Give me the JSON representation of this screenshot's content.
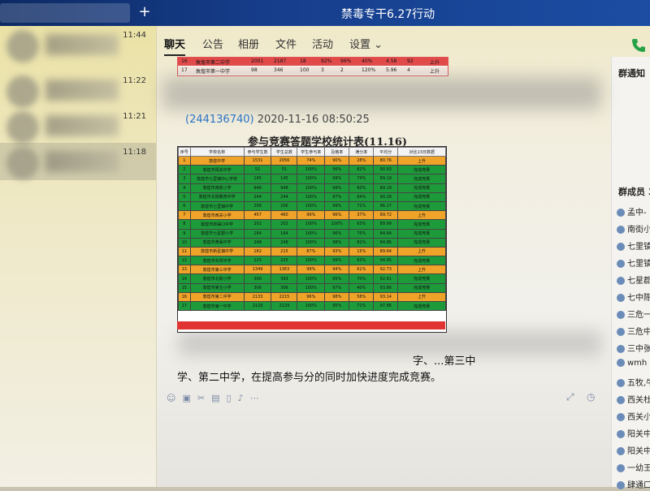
{
  "window": {
    "title": "禁毒专干6.27行动"
  },
  "sidebar": {
    "conversations": [
      {
        "time": "11:44"
      },
      {
        "time": "11:22"
      },
      {
        "time": "11:21"
      },
      {
        "time": "11:18",
        "selected": true
      }
    ]
  },
  "nav": {
    "tabs": [
      "聊天",
      "公告",
      "相册",
      "文件",
      "活动",
      "设置 ⌄"
    ],
    "active": 0
  },
  "right_panel": {
    "title": "群通知",
    "members_label": "群成员 3",
    "members": [
      "孟中-",
      "南街小",
      "七里镇",
      "七里镇",
      "七星郡",
      "七中陈",
      "三危一",
      "三危中",
      "三中张",
      "wmh",
      "五牧,牛",
      "西关杜",
      "西关小",
      "阳关中",
      "阳关中",
      "一幼王",
      "肆通口"
    ]
  },
  "chat": {
    "timestamp_id": "(244136740)",
    "timestamp": "2020-11-16 08:50:25",
    "table_title": "参与竞赛答题学校统计表(11.16)",
    "headers": [
      "序号",
      "学校名称",
      "参与学生数",
      "学生总数",
      "学生参与率",
      "及格率",
      "满分率",
      "平均分",
      "对比13日数据"
    ],
    "rows": [
      {
        "c": "o",
        "cells": [
          "1",
          "敦煌中学",
          "1531",
          "2056",
          "74%",
          "90%",
          "28%",
          "80.76",
          "上升"
        ]
      },
      {
        "c": "g",
        "cells": [
          "2",
          "敦煌市阳关中学",
          "51",
          "51",
          "100%",
          "96%",
          "82%",
          "90.93",
          "完成竞赛"
        ]
      },
      {
        "c": "g",
        "cells": [
          "3",
          "敦煌市七里镇中心学校",
          "145",
          "145",
          "100%",
          "99%",
          "74%",
          "89.19",
          "完成竞赛"
        ]
      },
      {
        "c": "g",
        "cells": [
          "4",
          "敦煌市南街小学",
          "946",
          "948",
          "100%",
          "99%",
          "60%",
          "89.19",
          "完成竞赛"
        ]
      },
      {
        "c": "g",
        "cells": [
          "5",
          "敦煌市北街教育中学",
          "244",
          "244",
          "100%",
          "97%",
          "64%",
          "90.28",
          "完成竞赛"
        ]
      },
      {
        "c": "g",
        "cells": [
          "6",
          "敦煌市七里镇中学",
          "206",
          "206",
          "100%",
          "99%",
          "71%",
          "96.17",
          "完成竞赛"
        ]
      },
      {
        "c": "o",
        "cells": [
          "7",
          "敦煌市西关小学",
          "457",
          "460",
          "99%",
          "96%",
          "37%",
          "89.72",
          "上升"
        ]
      },
      {
        "c": "g",
        "cells": [
          "8",
          "敦煌市转渠口中学",
          "202",
          "202",
          "100%",
          "100%",
          "63%",
          "89.99",
          "完成竞赛"
        ]
      },
      {
        "c": "g",
        "cells": [
          "9",
          "敦煌市七星郡小学",
          "164",
          "164",
          "100%",
          "96%",
          "75%",
          "84.64",
          "完成竞赛"
        ]
      },
      {
        "c": "g",
        "cells": [
          "10",
          "敦煌市黄渠中学",
          "248",
          "248",
          "100%",
          "98%",
          "82%",
          "84.86",
          "完成竞赛"
        ]
      },
      {
        "c": "o",
        "cells": [
          "11",
          "敦煌市新星镇中学",
          "182",
          "215",
          "87%",
          "93%",
          "15%",
          "89.64",
          "上升"
        ]
      },
      {
        "c": "g",
        "cells": [
          "12",
          "敦煌市东坝中学",
          "225",
          "225",
          "100%",
          "99%",
          "63%",
          "94.95",
          "完成竞赛"
        ]
      },
      {
        "c": "o",
        "cells": [
          "13",
          "敦煌市第三中学",
          "1349",
          "1363",
          "99%",
          "94%",
          "61%",
          "92.73",
          "上升"
        ]
      },
      {
        "c": "g",
        "cells": [
          "14",
          "敦煌市北街小学",
          "390",
          "393",
          "100%",
          "95%",
          "70%",
          "92.61",
          "完成竞赛"
        ]
      },
      {
        "c": "g",
        "cells": [
          "15",
          "敦煌市第五小学",
          "306",
          "306",
          "100%",
          "97%",
          "40%",
          "93.86",
          "完成竞赛"
        ]
      },
      {
        "c": "o",
        "cells": [
          "16",
          "敦煌市第二中学",
          "2133",
          "2215",
          "96%",
          "98%",
          "58%",
          "93.14",
          "上升"
        ]
      },
      {
        "c": "g",
        "cells": [
          "17",
          "敦煌市第一中学",
          "2129",
          "2129",
          "100%",
          "95%",
          "71%",
          "97.86",
          "完成竞赛"
        ]
      }
    ],
    "prev_table": {
      "row1": [
        "16",
        "敦煌市第二中学",
        "2001",
        "2187",
        "18",
        "92%",
        "96%",
        "40%",
        "4.58",
        "92",
        "上升"
      ],
      "row2": [
        "17",
        "敦煌市第一中学",
        "98",
        "346",
        "100",
        "3",
        "2",
        "120%",
        "5.96",
        "4",
        "上升"
      ]
    },
    "message_line1": "字、...第三中",
    "message_line2": "学、第二中学，在提高参与分的同时加快进度完成竞赛。",
    "toolbar_icons": [
      "emoji-icon",
      "screenshot-icon",
      "scissors-icon",
      "image-icon",
      "file-icon",
      "voice-icon",
      "more-icon"
    ]
  }
}
